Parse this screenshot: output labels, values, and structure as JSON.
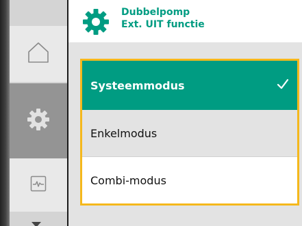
{
  "header": {
    "title_line1": "Dubbelpomp",
    "title_line2": "Ext. UIT functie",
    "icon": "gear-icon",
    "accent_color": "#009c82"
  },
  "sidebar": {
    "items": [
      {
        "icon": "home-icon",
        "active": false
      },
      {
        "icon": "gear-icon",
        "active": true
      },
      {
        "icon": "monitor-icon",
        "active": false
      }
    ],
    "scroll_indicator": "chevron-down-icon"
  },
  "menu": {
    "highlight_color": "#f5b81c",
    "items": [
      {
        "label": "Systeemmodus",
        "selected": true,
        "icon": "checkmark-icon"
      },
      {
        "label": "Enkelmodus",
        "selected": false
      },
      {
        "label": "Combi-modus",
        "selected": false
      }
    ]
  }
}
